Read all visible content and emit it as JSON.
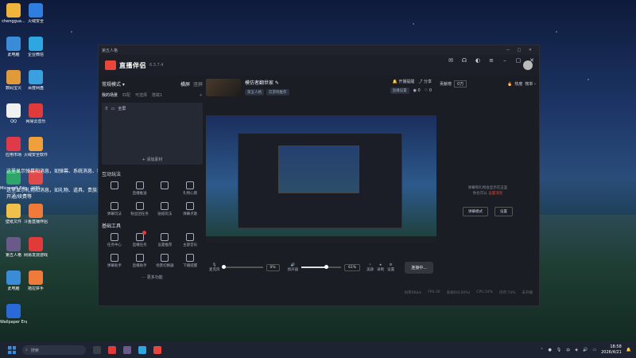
{
  "desktop": {
    "icons": [
      {
        "label": "chenggua...",
        "color": "#f0b43a"
      },
      {
        "label": "火绒安全",
        "color": "#2e7de0"
      },
      {
        "label": "此电脑",
        "color": "#3a8bd8"
      },
      {
        "label": "企业微信",
        "color": "#2ea6e0"
      },
      {
        "label": "数码宝贝",
        "color": "#e09a3a"
      },
      {
        "label": "百度网盘",
        "color": "#3aa0e0"
      },
      {
        "label": "QQ",
        "color": "#f0f0f0"
      },
      {
        "label": "网易云音乐",
        "color": "#e03a3a"
      },
      {
        "label": "应用市场",
        "color": "#e03a4a"
      },
      {
        "label": "火绒安全软件",
        "color": "#f0a03a"
      },
      {
        "label": "Microsoft Edge",
        "color": "#2ea66a"
      },
      {
        "label": "WPS",
        "color": "#e04a4a"
      },
      {
        "label": "壁纸文件",
        "color": "#f0c04a"
      },
      {
        "label": "斗鱼直播伴侣",
        "color": "#f07a3a"
      },
      {
        "label": "第五人格",
        "color": "#6a5a8a"
      },
      {
        "label": "网易发烧游戏",
        "color": "#e03a3a"
      },
      {
        "label": "此电脑",
        "color": "#3a8bd8"
      },
      {
        "label": "拖拉拼手",
        "color": "#f07a3a"
      },
      {
        "label": "Wallpaper Engine",
        "color": "#2a6ad8"
      }
    ],
    "tip_line1": "这里显示弹幕和消息，如弹幕、系统消息、粉丝牌升级等",
    "tip_line2": "这里显示礼物和消息，如礼物、道具、贵族开通/续费、贴粉",
    "tip_line3": "开通/续费等"
  },
  "window": {
    "outer_title": "第五人格",
    "brand": "直播伴侣",
    "version": "6.3.7.4",
    "header_right_status": ""
  },
  "left": {
    "mode_label": "常规模式",
    "orientation": "横屏",
    "orientation_alt": "竖屏",
    "tabs": [
      "我的场景",
      "匹配",
      "可选择",
      "搭载1"
    ],
    "scene_item": "全屏",
    "add_source": "+ 添加素材",
    "section_interact": "互动玩法",
    "interact_tools": [
      "",
      "直播推送",
      "",
      "礼物心愿",
      "弹幕玩法",
      "粉丝团任务",
      "贴纸玩法",
      "弹幕点歌"
    ],
    "section_basic": "基础工具",
    "basic_tools": [
      "任务中心",
      "直播任务",
      "设置推荐",
      "主题音乐",
      "弹幕助手",
      "直播助手",
      "场景切换器",
      "下播提醒"
    ],
    "more": "更多功能"
  },
  "center": {
    "stream_title": "模仿者翻世家",
    "chips": [
      "第五人格",
      "云游戏推荐"
    ],
    "actions": [
      "开播提醒",
      "分享"
    ],
    "live_setup": "直播设置",
    "counts": [
      "0",
      "0"
    ],
    "mic_label": "麦克风",
    "mic_pct": "0%",
    "mic_value": 0,
    "speaker_label": "扬声器",
    "speaker_pct": "61%",
    "speaker_value": 61,
    "tools": [
      "美颜",
      "录制",
      "设置"
    ],
    "go_live": "连接中...",
    "status_items": [
      "码率0Kb/s",
      "FPS:30",
      "丢帧0(0.00%)",
      "CPU:24%",
      "内存:74%",
      "未开播"
    ]
  },
  "right": {
    "coins": "贡献榜",
    "fans": "0万",
    "hot": "热度",
    "rank": "榜单",
    "tip_line1": "弹幕和礼物会显示在这里",
    "tip_line2": "你也可以",
    "tip_link": "设置消息",
    "btn1": "弹幕模式",
    "btn2": "设置"
  },
  "taskbar": {
    "search": "搜索",
    "time": "18:58",
    "date": "2026/4/21",
    "lang": "中"
  }
}
